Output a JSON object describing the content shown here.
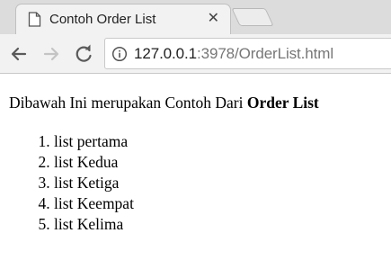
{
  "browser": {
    "tab": {
      "title": "Contoh Order List",
      "page_icon": "page-icon",
      "close_glyph": "✕"
    },
    "new_tab_icon": "new-tab-icon",
    "nav": {
      "back_icon": "back-arrow-icon",
      "forward_icon": "forward-arrow-icon",
      "reload_icon": "reload-icon"
    },
    "address_bar": {
      "security_icon": "info-icon",
      "host": "127.0.0.1",
      "rest": ":3978/OrderList.html"
    }
  },
  "page": {
    "intro_text": "Dibawah Ini merupakan Contoh Dari ",
    "intro_bold": "Order List",
    "list_items": [
      "list pertama",
      "list Kedua",
      "list Ketiga",
      "list Keempat",
      "list Kelima"
    ]
  },
  "colors": {
    "tabstrip": "#dcdcdc",
    "toolbar": "#f2f2f2",
    "url_host": "#222222",
    "url_rest": "#777777"
  }
}
